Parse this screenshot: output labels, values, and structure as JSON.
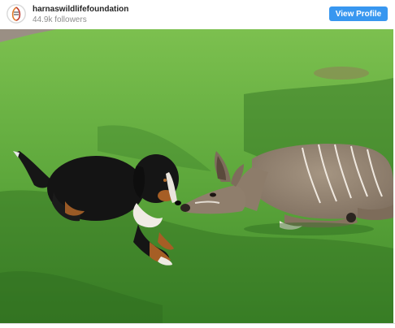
{
  "post": {
    "account_name": "harnaswildlifefoundation",
    "followers": "44.9k followers",
    "view_profile_label": "View Profile"
  },
  "icons": {
    "avatar": "harnas-logo-icon"
  },
  "colors": {
    "button": "#3897f0",
    "grass": "#5aa53a"
  }
}
